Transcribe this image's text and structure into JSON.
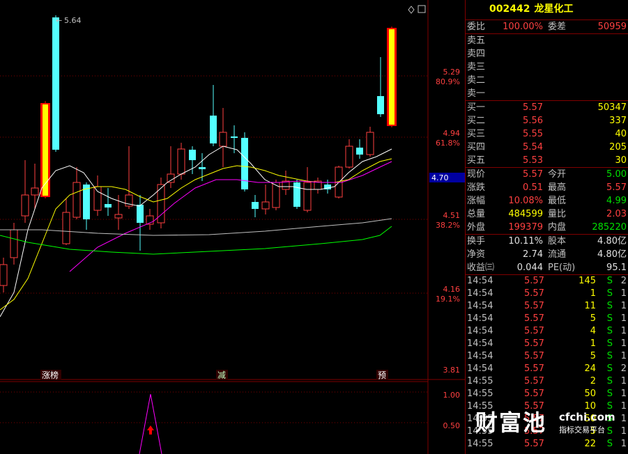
{
  "stock": {
    "code": "002442",
    "name": "龙星化工"
  },
  "chart": {
    "price_ticks": [
      {
        "price": "5.29",
        "pct": "80.9%"
      },
      {
        "price": "4.94",
        "pct": "61.8%"
      },
      {
        "price": "4.51",
        "pct": "38.2%"
      },
      {
        "price": "4.16",
        "pct": "19.1%"
      },
      {
        "price": "3.81",
        "pct": ""
      }
    ],
    "current_marker": "4.70",
    "max_label": "5.64",
    "signals": [
      "涨榜",
      "减",
      "预"
    ],
    "indicator_ticks": [
      "1.00",
      "0.50"
    ]
  },
  "quote": {
    "weibi_label": "委比",
    "weibi": "100.00%",
    "weicha_label": "委差",
    "weicha": "50959",
    "sell": [
      {
        "label": "卖五",
        "price": "",
        "vol": ""
      },
      {
        "label": "卖四",
        "price": "",
        "vol": ""
      },
      {
        "label": "卖三",
        "price": "",
        "vol": ""
      },
      {
        "label": "卖二",
        "price": "",
        "vol": ""
      },
      {
        "label": "卖一",
        "price": "",
        "vol": ""
      }
    ],
    "buy": [
      {
        "label": "买一",
        "price": "5.57",
        "vol": "50347"
      },
      {
        "label": "买二",
        "price": "5.56",
        "vol": "337"
      },
      {
        "label": "买三",
        "price": "5.55",
        "vol": "40"
      },
      {
        "label": "买四",
        "price": "5.54",
        "vol": "205"
      },
      {
        "label": "买五",
        "price": "5.53",
        "vol": "30"
      }
    ],
    "stats": [
      {
        "l1": "现价",
        "v1": "5.57",
        "c1": "red",
        "l2": "今开",
        "v2": "5.00",
        "c2": "green"
      },
      {
        "l1": "涨跌",
        "v1": "0.51",
        "c1": "red",
        "l2": "最高",
        "v2": "5.57",
        "c2": "red"
      },
      {
        "l1": "涨幅",
        "v1": "10.08%",
        "c1": "red",
        "l2": "最低",
        "v2": "4.99",
        "c2": "green"
      },
      {
        "l1": "总量",
        "v1": "484599",
        "c1": "yellow",
        "l2": "量比",
        "v2": "2.03",
        "c2": "red"
      },
      {
        "l1": "外盘",
        "v1": "199379",
        "c1": "red",
        "l2": "内盘",
        "v2": "285220",
        "c2": "green"
      }
    ],
    "fund": [
      {
        "l1": "换手",
        "v1": "10.11%",
        "l2": "股本",
        "v2": "4.80亿"
      },
      {
        "l1": "净资",
        "v1": "2.74",
        "l2": "流通",
        "v2": "4.80亿"
      },
      {
        "l1": "收益㈢",
        "v1": "0.044",
        "l2": "PE(动)",
        "v2": "95.1"
      }
    ]
  },
  "ticks": [
    {
      "time": "14:54",
      "price": "5.57",
      "vol": "145",
      "side": "S",
      "n": "2"
    },
    {
      "time": "14:54",
      "price": "5.57",
      "vol": "1",
      "side": "S",
      "n": "1"
    },
    {
      "time": "14:54",
      "price": "5.57",
      "vol": "11",
      "side": "S",
      "n": "1"
    },
    {
      "time": "14:54",
      "price": "5.57",
      "vol": "5",
      "side": "S",
      "n": "1"
    },
    {
      "time": "14:54",
      "price": "5.57",
      "vol": "4",
      "side": "S",
      "n": "1"
    },
    {
      "time": "14:54",
      "price": "5.57",
      "vol": "1",
      "side": "S",
      "n": "1"
    },
    {
      "time": "14:54",
      "price": "5.57",
      "vol": "5",
      "side": "S",
      "n": "1"
    },
    {
      "time": "14:54",
      "price": "5.57",
      "vol": "24",
      "side": "S",
      "n": "2"
    },
    {
      "time": "14:55",
      "price": "5.57",
      "vol": "2",
      "side": "S",
      "n": "1"
    },
    {
      "time": "14:55",
      "price": "5.57",
      "vol": "50",
      "side": "S",
      "n": "1"
    },
    {
      "time": "14:55",
      "price": "5.57",
      "vol": "10",
      "side": "S",
      "n": "1"
    },
    {
      "time": "14:55",
      "price": "5.57",
      "vol": "50",
      "side": "S",
      "n": "1"
    },
    {
      "time": "14:55",
      "price": "5.57",
      "vol": "5",
      "side": "S",
      "n": "1"
    },
    {
      "time": "14:55",
      "price": "5.57",
      "vol": "22",
      "side": "S",
      "n": "1"
    }
  ],
  "watermark": {
    "main": "财富池",
    "site": "cfchi.com",
    "sub": "指标交易平台"
  },
  "colors": {
    "up": "#ff4040",
    "down": "#54ffff",
    "ma5": "#ffffff",
    "ma10": "#ffff00",
    "ma20": "#ff00ff",
    "ma60": "#00ff00",
    "ma120": "#c0c0c0",
    "limit": "#ffff00"
  }
}
